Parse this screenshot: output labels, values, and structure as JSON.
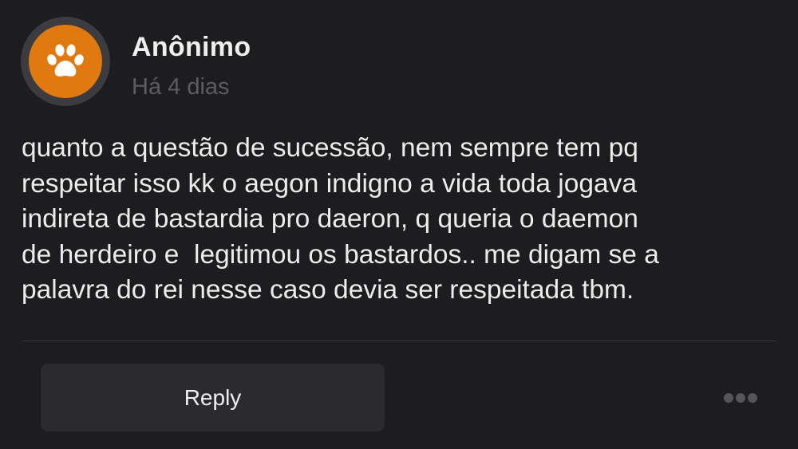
{
  "colors": {
    "background": "#1d1d20",
    "avatar": "#e0790f",
    "avatar_ring": "#3c3c40",
    "text_primary": "#ececec",
    "text_muted": "#5c5c62",
    "button_bg": "#2b2b2f"
  },
  "comment": {
    "avatar_icon": "paw-icon",
    "author": "Anônimo",
    "timestamp": "Há 4 dias",
    "body_lines": [
      "quanto a questão de sucessão, nem sempre tem pq",
      "respeitar isso kk o aegon indigno a vida toda jogava",
      "indireta de bastardia pro daeron, q queria o daemon",
      "de herdeiro e  legitimou os bastardos.. me digam se a",
      "palavra do rei nesse caso devia ser respeitada tbm."
    ]
  },
  "actions": {
    "reply_label": "Reply",
    "more_icon": "more-horizontal-icon"
  }
}
